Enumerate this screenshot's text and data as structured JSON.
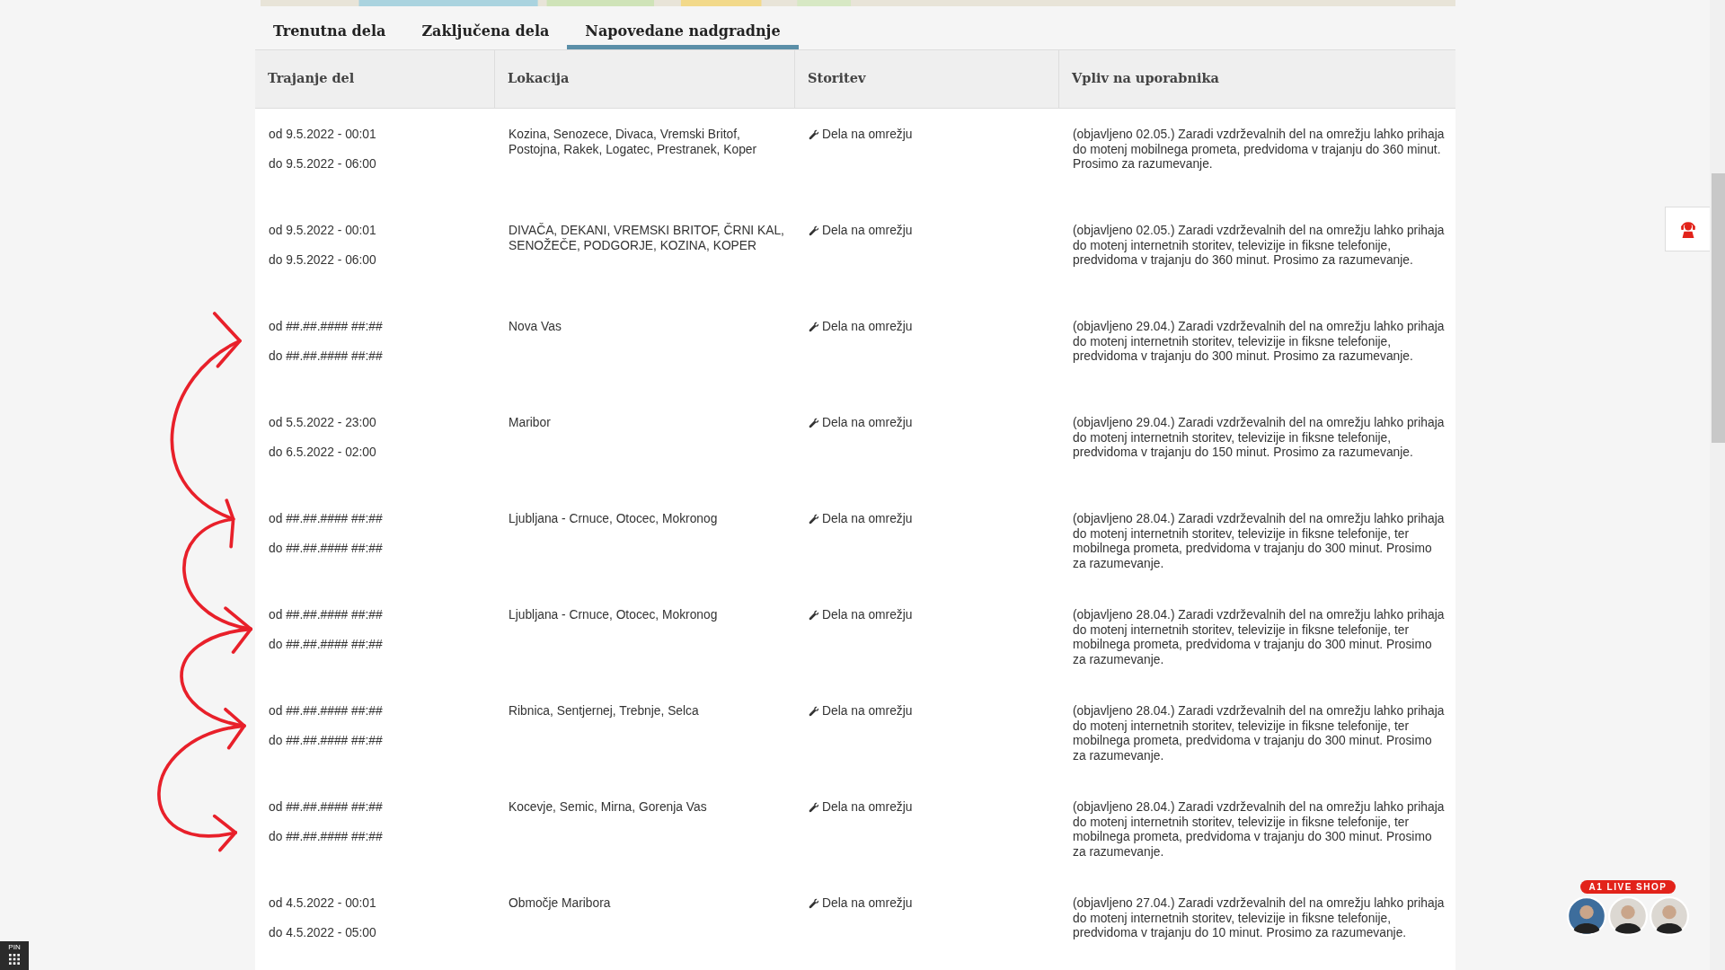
{
  "tabs": [
    {
      "label": "Trenutna dela",
      "selected": false
    },
    {
      "label": "Zaključena dela",
      "selected": false
    },
    {
      "label": "Napovedane nadgradnje",
      "selected": true
    }
  ],
  "table": {
    "columns": [
      "Trajanje del",
      "Lokacija",
      "Storitev",
      "Vpliv na uporabnika"
    ],
    "rows": [
      {
        "from": "od 9.5.2022 - 00:01",
        "to": "do 9.5.2022 - 06:00",
        "location": "Kozina, Senozece, Divaca, Vremski Britof, Postojna, Rakek, Logatec, Prestranek, Koper",
        "service": "Dela na omrežju",
        "impact": "(objavljeno 02.05.) Zaradi vzdrževalnih del na omrežju lahko prihaja do motenj mobilnega prometa, predvidoma v trajanju do 360 minut. Prosimo za razumevanje."
      },
      {
        "from": "od 9.5.2022 - 00:01",
        "to": "do 9.5.2022 - 06:00",
        "location": "DIVAČA, DEKANI, VREMSKI BRITOF, ČRNI KAL, SENOŽEČE, PODGORJE, KOZINA, KOPER",
        "service": "Dela na omrežju",
        "impact": "(objavljeno 02.05.) Zaradi vzdrževalnih del na omrežju lahko prihaja do motenj internetnih storitev, televizije in fiksne telefonije, predvidoma v trajanju do 360 minut. Prosimo za razumevanje."
      },
      {
        "from": "od ##.##.#### ##:##",
        "to": "do ##.##.#### ##:##",
        "location": "Nova Vas",
        "service": "Dela na omrežju",
        "impact": "(objavljeno 29.04.) Zaradi vzdrževalnih del na omrežju lahko prihaja do motenj internetnih storitev, televizije in fiksne telefonije, predvidoma v trajanju do 300 minut. Prosimo za razumevanje."
      },
      {
        "from": "od 5.5.2022 - 23:00",
        "to": "do 6.5.2022 - 02:00",
        "location": "Maribor",
        "service": "Dela na omrežju",
        "impact": "(objavljeno 29.04.) Zaradi vzdrževalnih del na omrežju lahko prihaja do motenj internetnih storitev, televizije in fiksne telefonije, predvidoma v trajanju do 150 minut. Prosimo za razumevanje."
      },
      {
        "from": "od ##.##.#### ##:##",
        "to": "do ##.##.#### ##:##",
        "location": "Ljubljana - Crnuce, Otocec, Mokronog",
        "service": "Dela na omrežju",
        "impact": "(objavljeno 28.04.) Zaradi vzdrževalnih del na omrežju lahko prihaja do motenj internetnih storitev, televizije in fiksne telefonije, ter mobilnega prometa, predvidoma v trajanju do 300 minut. Prosimo za razumevanje."
      },
      {
        "from": "od ##.##.#### ##:##",
        "to": "do ##.##.#### ##:##",
        "location": "Ljubljana - Crnuce, Otocec, Mokronog",
        "service": "Dela na omrežju",
        "impact": "(objavljeno 28.04.) Zaradi vzdrževalnih del na omrežju lahko prihaja do motenj internetnih storitev, televizije in fiksne telefonije, ter mobilnega prometa, predvidoma v trajanju do 300 minut. Prosimo za razumevanje."
      },
      {
        "from": "od ##.##.#### ##:##",
        "to": "do ##.##.#### ##:##",
        "location": "Ribnica, Sentjernej, Trebnje, Selca",
        "service": "Dela na omrežju",
        "impact": "(objavljeno 28.04.) Zaradi vzdrževalnih del na omrežju lahko prihaja do motenj internetnih storitev, televizije in fiksne telefonije, ter mobilnega prometa, predvidoma v trajanju do 300 minut. Prosimo za razumevanje."
      },
      {
        "from": "od ##.##.#### ##:##",
        "to": "do ##.##.#### ##:##",
        "location": "Kocevje, Semic, Mirna, Gorenja Vas",
        "service": "Dela na omrežju",
        "impact": "(objavljeno 28.04.) Zaradi vzdrževalnih del na omrežju lahko prihaja do motenj internetnih storitev, televizije in fiksne telefonije, ter mobilnega prometa, predvidoma v trajanju do 300 minut. Prosimo za razumevanje."
      },
      {
        "from": "od 4.5.2022 - 00:01",
        "to": "do 4.5.2022 - 05:00",
        "location": "Območje Maribora",
        "service": "Dela na omrežju",
        "impact": "(objavljeno 27.04.) Zaradi vzdrževalnih del na omrežju lahko prihaja do motenj internetnih storitev, televizije in fiksne telefonije, predvidoma v trajanju do 10 minut. Prosimo za razumevanje."
      }
    ]
  },
  "live_shop": {
    "label": "A1 LIVE SHOP"
  },
  "pin_widget": {
    "label": "PIN"
  }
}
